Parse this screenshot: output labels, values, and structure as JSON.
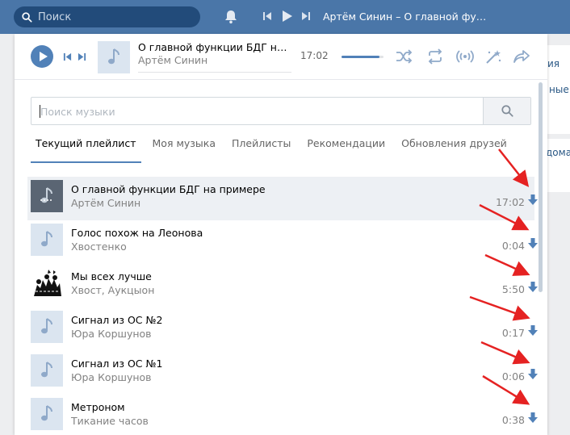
{
  "topbar": {
    "search_placeholder": "Поиск",
    "now_playing": "Артём Синин – О главной функции БДГ на примере"
  },
  "background_page": {
    "fragments": [
      "ия",
      "ные",
      "дома"
    ]
  },
  "player": {
    "title": "О главной функции БДГ на примере",
    "artist": "Артём Синин",
    "time": "17:02",
    "progress": 0.0,
    "volume": 0.9
  },
  "search": {
    "placeholder": "Поиск музыки"
  },
  "tabs": [
    {
      "label": "Текущий плейлист",
      "active": true
    },
    {
      "label": "Моя музыка",
      "active": false
    },
    {
      "label": "Плейлисты",
      "active": false
    },
    {
      "label": "Рекомендации",
      "active": false
    },
    {
      "label": "Обновления друзей",
      "active": false
    }
  ],
  "tracks": [
    {
      "title": "О главной функции БДГ на примере",
      "artist": "Артём Синин",
      "duration": "17:02",
      "active": true,
      "cover": "playing"
    },
    {
      "title": "Голос похож на Леонова",
      "artist": "Хвостенко",
      "duration": "0:04",
      "active": false,
      "cover": "note"
    },
    {
      "title": "Мы всех лучше",
      "artist": "Хвост, Аукцыон",
      "duration": "5:50",
      "active": false,
      "cover": "art"
    },
    {
      "title": "Сигнал из ОС №2",
      "artist": "Юра Коршунов",
      "duration": "0:17",
      "active": false,
      "cover": "note"
    },
    {
      "title": "Сигнал из ОС №1",
      "artist": "Юра Коршунов",
      "duration": "0:06",
      "active": false,
      "cover": "note"
    },
    {
      "title": "Метроном",
      "artist": "Тикание часов",
      "duration": "0:38",
      "active": false,
      "cover": "note"
    }
  ],
  "colors": {
    "brand": "#4a76a8",
    "accent": "#5181b8",
    "annotation_arrow": "#e52222"
  }
}
